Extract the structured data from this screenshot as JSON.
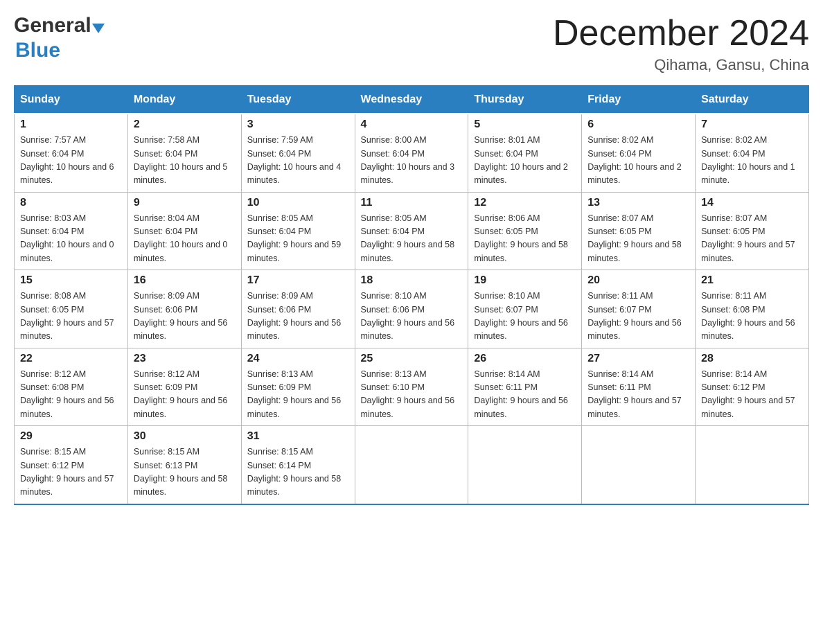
{
  "logo": {
    "general": "General",
    "blue": "Blue"
  },
  "title": "December 2024",
  "location": "Qihama, Gansu, China",
  "days_of_week": [
    "Sunday",
    "Monday",
    "Tuesday",
    "Wednesday",
    "Thursday",
    "Friday",
    "Saturday"
  ],
  "weeks": [
    [
      {
        "day": "1",
        "sunrise": "7:57 AM",
        "sunset": "6:04 PM",
        "daylight": "10 hours and 6 minutes."
      },
      {
        "day": "2",
        "sunrise": "7:58 AM",
        "sunset": "6:04 PM",
        "daylight": "10 hours and 5 minutes."
      },
      {
        "day": "3",
        "sunrise": "7:59 AM",
        "sunset": "6:04 PM",
        "daylight": "10 hours and 4 minutes."
      },
      {
        "day": "4",
        "sunrise": "8:00 AM",
        "sunset": "6:04 PM",
        "daylight": "10 hours and 3 minutes."
      },
      {
        "day": "5",
        "sunrise": "8:01 AM",
        "sunset": "6:04 PM",
        "daylight": "10 hours and 2 minutes."
      },
      {
        "day": "6",
        "sunrise": "8:02 AM",
        "sunset": "6:04 PM",
        "daylight": "10 hours and 2 minutes."
      },
      {
        "day": "7",
        "sunrise": "8:02 AM",
        "sunset": "6:04 PM",
        "daylight": "10 hours and 1 minute."
      }
    ],
    [
      {
        "day": "8",
        "sunrise": "8:03 AM",
        "sunset": "6:04 PM",
        "daylight": "10 hours and 0 minutes."
      },
      {
        "day": "9",
        "sunrise": "8:04 AM",
        "sunset": "6:04 PM",
        "daylight": "10 hours and 0 minutes."
      },
      {
        "day": "10",
        "sunrise": "8:05 AM",
        "sunset": "6:04 PM",
        "daylight": "9 hours and 59 minutes."
      },
      {
        "day": "11",
        "sunrise": "8:05 AM",
        "sunset": "6:04 PM",
        "daylight": "9 hours and 58 minutes."
      },
      {
        "day": "12",
        "sunrise": "8:06 AM",
        "sunset": "6:05 PM",
        "daylight": "9 hours and 58 minutes."
      },
      {
        "day": "13",
        "sunrise": "8:07 AM",
        "sunset": "6:05 PM",
        "daylight": "9 hours and 58 minutes."
      },
      {
        "day": "14",
        "sunrise": "8:07 AM",
        "sunset": "6:05 PM",
        "daylight": "9 hours and 57 minutes."
      }
    ],
    [
      {
        "day": "15",
        "sunrise": "8:08 AM",
        "sunset": "6:05 PM",
        "daylight": "9 hours and 57 minutes."
      },
      {
        "day": "16",
        "sunrise": "8:09 AM",
        "sunset": "6:06 PM",
        "daylight": "9 hours and 56 minutes."
      },
      {
        "day": "17",
        "sunrise": "8:09 AM",
        "sunset": "6:06 PM",
        "daylight": "9 hours and 56 minutes."
      },
      {
        "day": "18",
        "sunrise": "8:10 AM",
        "sunset": "6:06 PM",
        "daylight": "9 hours and 56 minutes."
      },
      {
        "day": "19",
        "sunrise": "8:10 AM",
        "sunset": "6:07 PM",
        "daylight": "9 hours and 56 minutes."
      },
      {
        "day": "20",
        "sunrise": "8:11 AM",
        "sunset": "6:07 PM",
        "daylight": "9 hours and 56 minutes."
      },
      {
        "day": "21",
        "sunrise": "8:11 AM",
        "sunset": "6:08 PM",
        "daylight": "9 hours and 56 minutes."
      }
    ],
    [
      {
        "day": "22",
        "sunrise": "8:12 AM",
        "sunset": "6:08 PM",
        "daylight": "9 hours and 56 minutes."
      },
      {
        "day": "23",
        "sunrise": "8:12 AM",
        "sunset": "6:09 PM",
        "daylight": "9 hours and 56 minutes."
      },
      {
        "day": "24",
        "sunrise": "8:13 AM",
        "sunset": "6:09 PM",
        "daylight": "9 hours and 56 minutes."
      },
      {
        "day": "25",
        "sunrise": "8:13 AM",
        "sunset": "6:10 PM",
        "daylight": "9 hours and 56 minutes."
      },
      {
        "day": "26",
        "sunrise": "8:14 AM",
        "sunset": "6:11 PM",
        "daylight": "9 hours and 56 minutes."
      },
      {
        "day": "27",
        "sunrise": "8:14 AM",
        "sunset": "6:11 PM",
        "daylight": "9 hours and 57 minutes."
      },
      {
        "day": "28",
        "sunrise": "8:14 AM",
        "sunset": "6:12 PM",
        "daylight": "9 hours and 57 minutes."
      }
    ],
    [
      {
        "day": "29",
        "sunrise": "8:15 AM",
        "sunset": "6:12 PM",
        "daylight": "9 hours and 57 minutes."
      },
      {
        "day": "30",
        "sunrise": "8:15 AM",
        "sunset": "6:13 PM",
        "daylight": "9 hours and 58 minutes."
      },
      {
        "day": "31",
        "sunrise": "8:15 AM",
        "sunset": "6:14 PM",
        "daylight": "9 hours and 58 minutes."
      },
      null,
      null,
      null,
      null
    ]
  ],
  "labels": {
    "sunrise": "Sunrise:",
    "sunset": "Sunset:",
    "daylight": "Daylight:"
  }
}
